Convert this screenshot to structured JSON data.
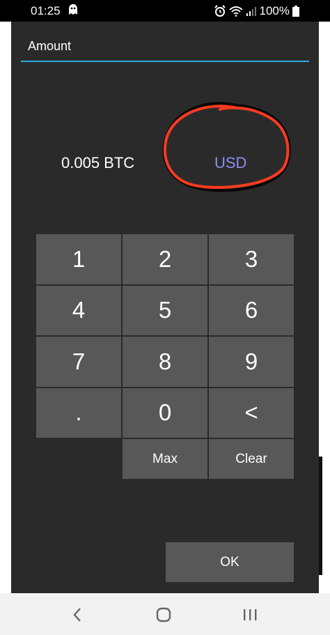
{
  "status_bar": {
    "time": "01:25",
    "battery": "100%",
    "icons": [
      "ghost-app-icon",
      "alarm-icon",
      "wifi-icon",
      "signal-icon",
      "battery-icon"
    ]
  },
  "dialog": {
    "title": "Amount",
    "amount_value": "0.005 BTC",
    "currency_toggle": "USD",
    "colors": {
      "background": "#2a2a2a",
      "key": "#585858",
      "underline": "#33aadd",
      "toggle_text": "#8d8df0",
      "annotation": "#ff3b1f"
    }
  },
  "keypad": {
    "keys": [
      "1",
      "2",
      "3",
      "4",
      "5",
      "6",
      "7",
      "8",
      "9",
      ".",
      "0",
      "<"
    ],
    "max_label": "Max",
    "clear_label": "Clear"
  },
  "ok_label": "OK",
  "nav_bar": {
    "icons": [
      "back-icon",
      "home-icon",
      "recent-apps-icon"
    ]
  }
}
